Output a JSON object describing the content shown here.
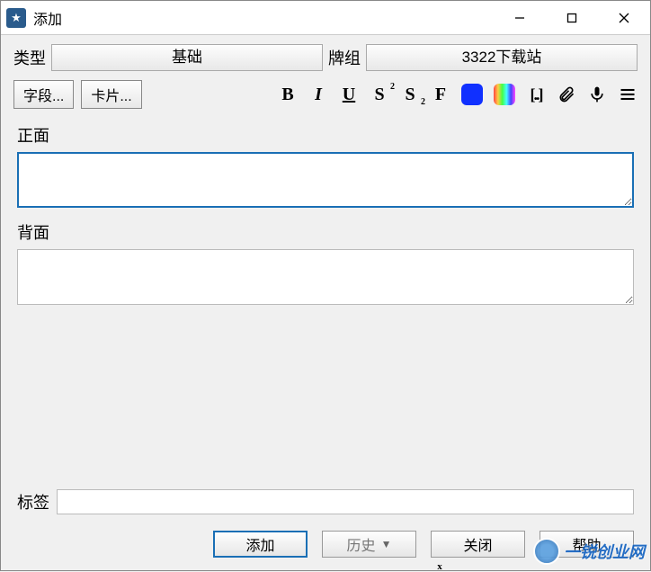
{
  "window": {
    "title": "添加"
  },
  "selectors": {
    "type_label": "类型",
    "type_value": "基础",
    "deck_label": "牌组",
    "deck_value": "3322下载站"
  },
  "toolbar": {
    "fields_btn": "字段...",
    "cards_btn": "卡片..."
  },
  "fields": {
    "front_label": "正面",
    "front_value": "",
    "back_label": "背面",
    "back_value": ""
  },
  "tags": {
    "label": "标签",
    "value": ""
  },
  "footer": {
    "add": "添加",
    "history": "历史",
    "close": "关闭",
    "help": "帮助"
  },
  "watermark": {
    "text": "一锐创业网"
  }
}
